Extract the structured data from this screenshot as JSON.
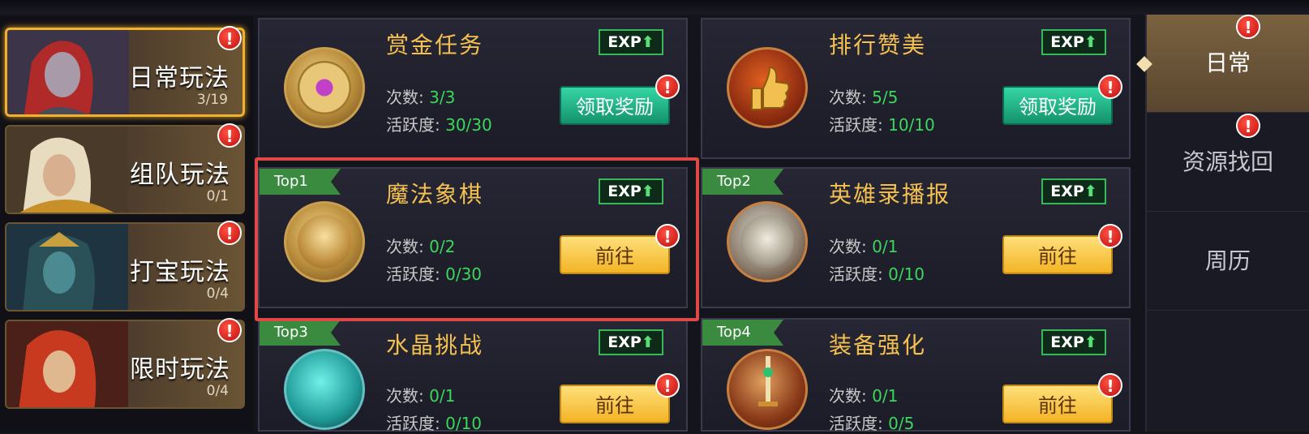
{
  "categories": [
    {
      "name": "日常玩法",
      "count": "3/19",
      "active": true
    },
    {
      "name": "组队玩法",
      "count": "0/1",
      "active": false
    },
    {
      "name": "打宝玩法",
      "count": "0/4",
      "active": false
    },
    {
      "name": "限时玩法",
      "count": "0/4",
      "active": false
    }
  ],
  "alert_glyph": "!",
  "exp_label": "EXP",
  "exp_arrow": "⬆",
  "labels": {
    "times": "次数:",
    "activity": "活跃度:"
  },
  "cards": [
    {
      "title": "赏金任务",
      "times": "3/3",
      "activity": "30/30",
      "button": "领取奖励",
      "rank": ""
    },
    {
      "title": "排行赞美",
      "times": "5/5",
      "activity": "10/10",
      "button": "领取奖励",
      "rank": ""
    },
    {
      "title": "魔法象棋",
      "times": "0/2",
      "activity": "0/30",
      "button": "前往",
      "rank": "Top1"
    },
    {
      "title": "英雄录播报",
      "times": "0/1",
      "activity": "0/10",
      "button": "前往",
      "rank": "Top2"
    },
    {
      "title": "水晶挑战",
      "times": "0/1",
      "activity": "0/10",
      "button": "前往",
      "rank": "Top3"
    },
    {
      "title": "装备强化",
      "times": "0/1",
      "activity": "0/5",
      "button": "前往",
      "rank": "Top4"
    }
  ],
  "tabs": [
    {
      "label": "日常",
      "active": true
    },
    {
      "label": "资源找回",
      "active": false
    },
    {
      "label": "周历",
      "active": false
    }
  ],
  "colors": {
    "accent_gold": "#f4c050",
    "value_green": "#3ad85a",
    "alert_red": "#e02020",
    "highlight_red": "#e04848"
  }
}
